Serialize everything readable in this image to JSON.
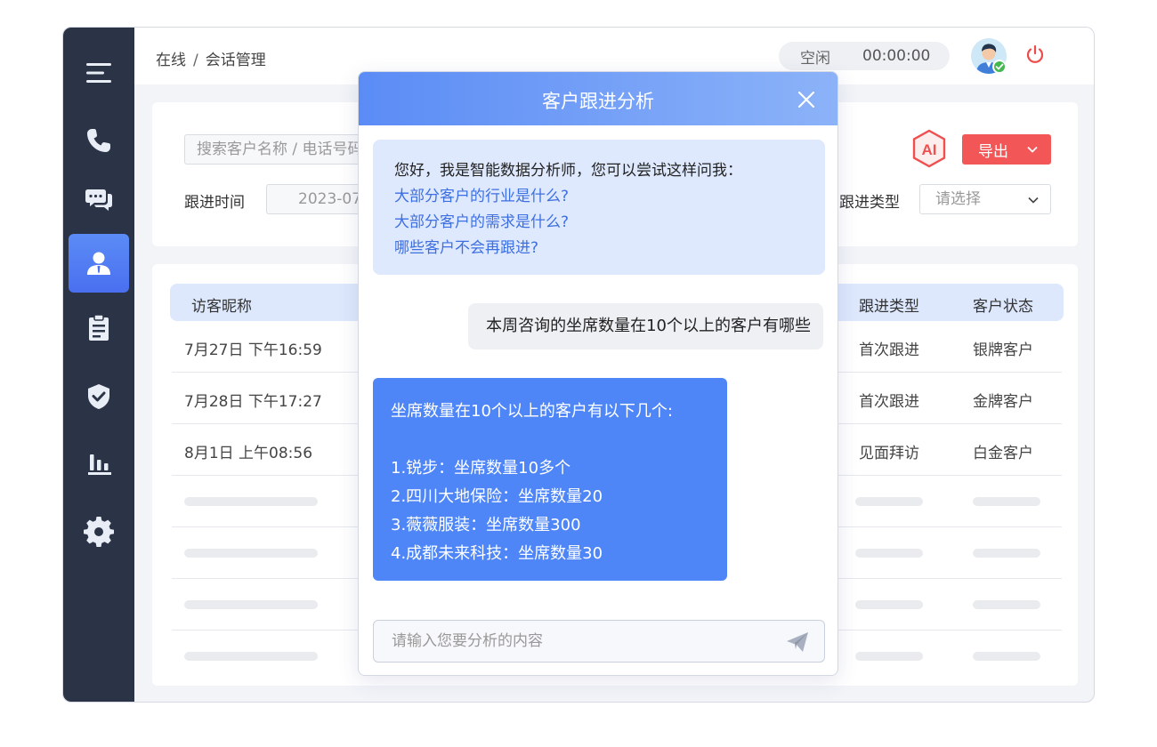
{
  "breadcrumb": {
    "root": "在线",
    "separator": "/",
    "current": "会话管理"
  },
  "status": {
    "state": "空闲",
    "timer": "00:00:00"
  },
  "filters": {
    "search_placeholder": "搜索客户名称 / 电话号码",
    "time_label": "跟进时间",
    "date_value": "2023-07-",
    "type_label": "跟进类型",
    "type_placeholder": "请选择",
    "export_label": "导出",
    "ai_label": "AI"
  },
  "table": {
    "headers": {
      "visitor": "访客昵称",
      "type": "跟进类型",
      "status": "客户状态"
    },
    "rows": [
      {
        "time": "7月27日  下午16:59",
        "type": "首次跟进",
        "status": "银牌客户"
      },
      {
        "time": "7月28日  下午17:27",
        "type": "首次跟进",
        "status": "金牌客户"
      },
      {
        "time": "8月1日  上午08:56",
        "type": "见面拜访",
        "status": "白金客户"
      }
    ]
  },
  "dialog": {
    "title": "客户跟进分析",
    "intro": "您好，我是智能数据分析师，您可以尝试这样问我：",
    "suggestions": [
      "大部分客户的行业是什么?",
      "大部分客户的需求是什么?",
      "哪些客户不会再跟进?"
    ],
    "user_message": "本周咨询的坐席数量在10个以上的客户有哪些",
    "ai_reply": {
      "heading": "坐席数量在10个以上的客户有以下几个:",
      "items": [
        "1.锐步：坐席数量10多个",
        "2.四川大地保险：坐席数量20",
        "3.薇薇服装：坐席数量300",
        "4.成都未来科技：坐席数量30"
      ]
    },
    "input_placeholder": "请输入您要分析的内容"
  },
  "colors": {
    "sidebar_bg": "#2b3447",
    "accent_blue": "#4f86f7",
    "export_red": "#f25656",
    "table_header_bg": "#dde8fd"
  }
}
